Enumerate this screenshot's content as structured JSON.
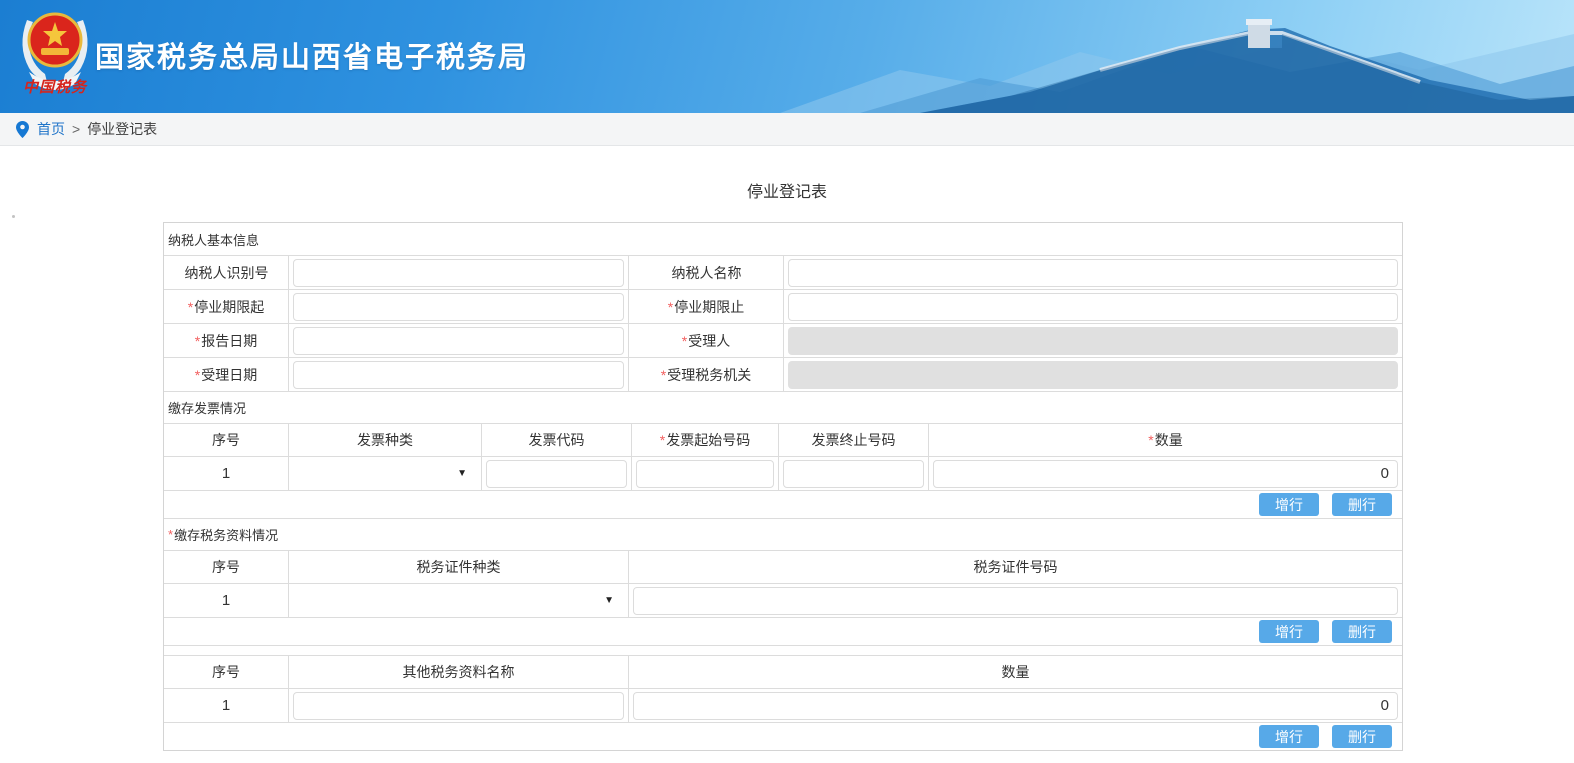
{
  "header": {
    "title": "国家税务总局山西省电子税务局",
    "logo_text": "中国税务"
  },
  "breadcrumb": {
    "home": "首页",
    "separator": ">",
    "current": "停业登记表"
  },
  "page": {
    "title": "停业登记表"
  },
  "buttons": {
    "add": "增行",
    "del": "删行"
  },
  "basic_info": {
    "section_title": "纳税人基本信息",
    "fields": [
      {
        "req": "",
        "label": "纳税人识别号",
        "value": "",
        "disabled": false
      },
      {
        "req": "",
        "label": "纳税人名称",
        "value": "",
        "disabled": false
      },
      {
        "req": "*",
        "label": "停业期限起",
        "value": "",
        "disabled": false
      },
      {
        "req": "*",
        "label": "停业期限止",
        "value": "",
        "disabled": false
      },
      {
        "req": "*",
        "label": "报告日期",
        "value": "",
        "disabled": false
      },
      {
        "req": "*",
        "label": "受理人",
        "value": "",
        "disabled": true
      },
      {
        "req": "*",
        "label": "受理日期",
        "value": "",
        "disabled": false
      },
      {
        "req": "*",
        "label": "受理税务机关",
        "value": "",
        "disabled": true
      }
    ]
  },
  "invoice_section": {
    "title": "缴存发票情况",
    "columns": [
      {
        "req": "",
        "label": "序号"
      },
      {
        "req": "",
        "label": "发票种类"
      },
      {
        "req": "",
        "label": "发票代码"
      },
      {
        "req": "*",
        "label": "发票起始号码"
      },
      {
        "req": "",
        "label": "发票终止号码"
      },
      {
        "req": "*",
        "label": "数量"
      }
    ],
    "row": {
      "index": "1",
      "invoice_type": "",
      "invoice_code": "",
      "start_no": "",
      "end_no": "",
      "quantity": "0"
    }
  },
  "cert_section": {
    "req": "*",
    "title": "缴存税务资料情况",
    "columns": [
      {
        "req": "",
        "label": "序号"
      },
      {
        "req": "",
        "label": "税务证件种类"
      },
      {
        "req": "",
        "label": "税务证件号码"
      }
    ],
    "row": {
      "index": "1",
      "cert_type": "",
      "cert_no": ""
    }
  },
  "other_section": {
    "columns": [
      {
        "req": "",
        "label": "序号"
      },
      {
        "req": "",
        "label": "其他税务资料名称"
      },
      {
        "req": "",
        "label": "数量"
      }
    ],
    "row": {
      "index": "1",
      "name": "",
      "quantity": "0"
    }
  }
}
